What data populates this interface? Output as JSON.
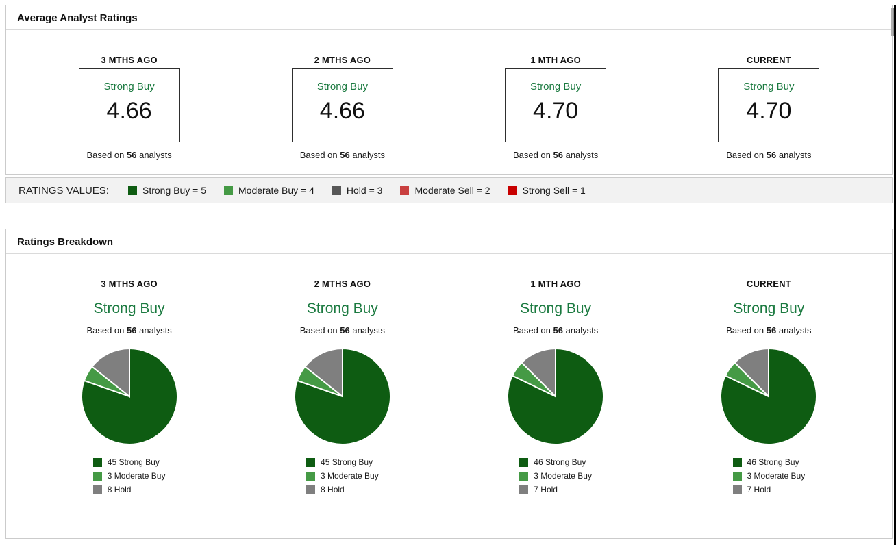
{
  "colors": {
    "strong_buy": "#0e5c12",
    "moderate_buy": "#459a45",
    "hold_bar": "#575757",
    "hold_pie": "#7f7f7f",
    "moderate_sell": "#c94040",
    "strong_sell": "#c80000",
    "rating_text_green": "#1b7a40"
  },
  "average_panel": {
    "title": "Average Analyst Ratings",
    "columns": [
      {
        "period": "3 MTHS AGO",
        "rating": "Strong Buy",
        "value": "4.66",
        "based_prefix": "Based on",
        "analysts": "56",
        "based_suffix": "analysts"
      },
      {
        "period": "2 MTHS AGO",
        "rating": "Strong Buy",
        "value": "4.66",
        "based_prefix": "Based on",
        "analysts": "56",
        "based_suffix": "analysts"
      },
      {
        "period": "1 MTH AGO",
        "rating": "Strong Buy",
        "value": "4.70",
        "based_prefix": "Based on",
        "analysts": "56",
        "based_suffix": "analysts"
      },
      {
        "period": "CURRENT",
        "rating": "Strong Buy",
        "value": "4.70",
        "based_prefix": "Based on",
        "analysts": "56",
        "based_suffix": "analysts"
      }
    ]
  },
  "ratings_values": {
    "label": "RATINGS VALUES:",
    "items": [
      {
        "label": "Strong Buy = 5",
        "color": "#0e5c12"
      },
      {
        "label": "Moderate Buy = 4",
        "color": "#459a45"
      },
      {
        "label": "Hold = 3",
        "color": "#575757"
      },
      {
        "label": "Moderate Sell = 2",
        "color": "#c94040"
      },
      {
        "label": "Strong Sell = 1",
        "color": "#c80000"
      }
    ]
  },
  "breakdown_panel": {
    "title": "Ratings Breakdown",
    "columns": [
      {
        "period": "3 MTHS AGO",
        "rating": "Strong Buy",
        "based_prefix": "Based on",
        "analysts": "56",
        "based_suffix": "analysts"
      },
      {
        "period": "2 MTHS AGO",
        "rating": "Strong Buy",
        "based_prefix": "Based on",
        "analysts": "56",
        "based_suffix": "analysts"
      },
      {
        "period": "1 MTH AGO",
        "rating": "Strong Buy",
        "based_prefix": "Based on",
        "analysts": "56",
        "based_suffix": "analysts"
      },
      {
        "period": "CURRENT",
        "rating": "Strong Buy",
        "based_prefix": "Based on",
        "analysts": "56",
        "based_suffix": "analysts"
      }
    ]
  },
  "chart_data": [
    {
      "type": "pie",
      "title": "3 MTHS AGO",
      "overall_rating": "Strong Buy",
      "based_on_analysts": 56,
      "start_angle_deg": 0,
      "direction": "clockwise",
      "legend_position": "bottom",
      "slices": [
        {
          "label": "Strong Buy",
          "value": 45,
          "color": "#0e5c12"
        },
        {
          "label": "Moderate Buy",
          "value": 3,
          "color": "#459a45"
        },
        {
          "label": "Hold",
          "value": 8,
          "color": "#7f7f7f"
        }
      ]
    },
    {
      "type": "pie",
      "title": "2 MTHS AGO",
      "overall_rating": "Strong Buy",
      "based_on_analysts": 56,
      "start_angle_deg": 0,
      "direction": "clockwise",
      "legend_position": "bottom",
      "slices": [
        {
          "label": "Strong Buy",
          "value": 45,
          "color": "#0e5c12"
        },
        {
          "label": "Moderate Buy",
          "value": 3,
          "color": "#459a45"
        },
        {
          "label": "Hold",
          "value": 8,
          "color": "#7f7f7f"
        }
      ]
    },
    {
      "type": "pie",
      "title": "1 MTH AGO",
      "overall_rating": "Strong Buy",
      "based_on_analysts": 56,
      "start_angle_deg": 0,
      "direction": "clockwise",
      "legend_position": "bottom",
      "slices": [
        {
          "label": "Strong Buy",
          "value": 46,
          "color": "#0e5c12"
        },
        {
          "label": "Moderate Buy",
          "value": 3,
          "color": "#459a45"
        },
        {
          "label": "Hold",
          "value": 7,
          "color": "#7f7f7f"
        }
      ]
    },
    {
      "type": "pie",
      "title": "CURRENT",
      "overall_rating": "Strong Buy",
      "based_on_analysts": 56,
      "start_angle_deg": 0,
      "direction": "clockwise",
      "legend_position": "bottom",
      "slices": [
        {
          "label": "Strong Buy",
          "value": 46,
          "color": "#0e5c12"
        },
        {
          "label": "Moderate Buy",
          "value": 3,
          "color": "#459a45"
        },
        {
          "label": "Hold",
          "value": 7,
          "color": "#7f7f7f"
        }
      ]
    }
  ]
}
